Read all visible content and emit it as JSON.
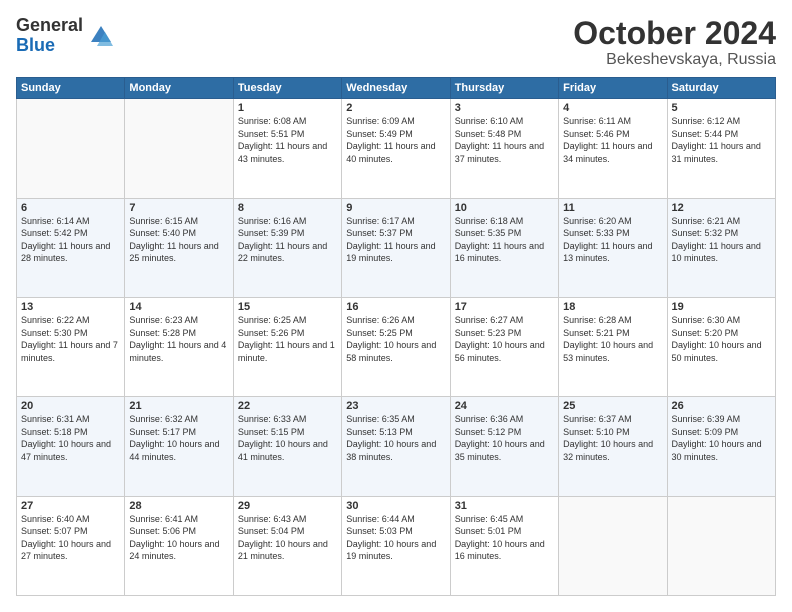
{
  "logo": {
    "general": "General",
    "blue": "Blue"
  },
  "title": "October 2024",
  "subtitle": "Bekeshevskaya, Russia",
  "headers": [
    "Sunday",
    "Monday",
    "Tuesday",
    "Wednesday",
    "Thursday",
    "Friday",
    "Saturday"
  ],
  "weeks": [
    [
      {
        "day": "",
        "info": ""
      },
      {
        "day": "",
        "info": ""
      },
      {
        "day": "1",
        "info": "Sunrise: 6:08 AM\nSunset: 5:51 PM\nDaylight: 11 hours and 43 minutes."
      },
      {
        "day": "2",
        "info": "Sunrise: 6:09 AM\nSunset: 5:49 PM\nDaylight: 11 hours and 40 minutes."
      },
      {
        "day": "3",
        "info": "Sunrise: 6:10 AM\nSunset: 5:48 PM\nDaylight: 11 hours and 37 minutes."
      },
      {
        "day": "4",
        "info": "Sunrise: 6:11 AM\nSunset: 5:46 PM\nDaylight: 11 hours and 34 minutes."
      },
      {
        "day": "5",
        "info": "Sunrise: 6:12 AM\nSunset: 5:44 PM\nDaylight: 11 hours and 31 minutes."
      }
    ],
    [
      {
        "day": "6",
        "info": "Sunrise: 6:14 AM\nSunset: 5:42 PM\nDaylight: 11 hours and 28 minutes."
      },
      {
        "day": "7",
        "info": "Sunrise: 6:15 AM\nSunset: 5:40 PM\nDaylight: 11 hours and 25 minutes."
      },
      {
        "day": "8",
        "info": "Sunrise: 6:16 AM\nSunset: 5:39 PM\nDaylight: 11 hours and 22 minutes."
      },
      {
        "day": "9",
        "info": "Sunrise: 6:17 AM\nSunset: 5:37 PM\nDaylight: 11 hours and 19 minutes."
      },
      {
        "day": "10",
        "info": "Sunrise: 6:18 AM\nSunset: 5:35 PM\nDaylight: 11 hours and 16 minutes."
      },
      {
        "day": "11",
        "info": "Sunrise: 6:20 AM\nSunset: 5:33 PM\nDaylight: 11 hours and 13 minutes."
      },
      {
        "day": "12",
        "info": "Sunrise: 6:21 AM\nSunset: 5:32 PM\nDaylight: 11 hours and 10 minutes."
      }
    ],
    [
      {
        "day": "13",
        "info": "Sunrise: 6:22 AM\nSunset: 5:30 PM\nDaylight: 11 hours and 7 minutes."
      },
      {
        "day": "14",
        "info": "Sunrise: 6:23 AM\nSunset: 5:28 PM\nDaylight: 11 hours and 4 minutes."
      },
      {
        "day": "15",
        "info": "Sunrise: 6:25 AM\nSunset: 5:26 PM\nDaylight: 11 hours and 1 minute."
      },
      {
        "day": "16",
        "info": "Sunrise: 6:26 AM\nSunset: 5:25 PM\nDaylight: 10 hours and 58 minutes."
      },
      {
        "day": "17",
        "info": "Sunrise: 6:27 AM\nSunset: 5:23 PM\nDaylight: 10 hours and 56 minutes."
      },
      {
        "day": "18",
        "info": "Sunrise: 6:28 AM\nSunset: 5:21 PM\nDaylight: 10 hours and 53 minutes."
      },
      {
        "day": "19",
        "info": "Sunrise: 6:30 AM\nSunset: 5:20 PM\nDaylight: 10 hours and 50 minutes."
      }
    ],
    [
      {
        "day": "20",
        "info": "Sunrise: 6:31 AM\nSunset: 5:18 PM\nDaylight: 10 hours and 47 minutes."
      },
      {
        "day": "21",
        "info": "Sunrise: 6:32 AM\nSunset: 5:17 PM\nDaylight: 10 hours and 44 minutes."
      },
      {
        "day": "22",
        "info": "Sunrise: 6:33 AM\nSunset: 5:15 PM\nDaylight: 10 hours and 41 minutes."
      },
      {
        "day": "23",
        "info": "Sunrise: 6:35 AM\nSunset: 5:13 PM\nDaylight: 10 hours and 38 minutes."
      },
      {
        "day": "24",
        "info": "Sunrise: 6:36 AM\nSunset: 5:12 PM\nDaylight: 10 hours and 35 minutes."
      },
      {
        "day": "25",
        "info": "Sunrise: 6:37 AM\nSunset: 5:10 PM\nDaylight: 10 hours and 32 minutes."
      },
      {
        "day": "26",
        "info": "Sunrise: 6:39 AM\nSunset: 5:09 PM\nDaylight: 10 hours and 30 minutes."
      }
    ],
    [
      {
        "day": "27",
        "info": "Sunrise: 6:40 AM\nSunset: 5:07 PM\nDaylight: 10 hours and 27 minutes."
      },
      {
        "day": "28",
        "info": "Sunrise: 6:41 AM\nSunset: 5:06 PM\nDaylight: 10 hours and 24 minutes."
      },
      {
        "day": "29",
        "info": "Sunrise: 6:43 AM\nSunset: 5:04 PM\nDaylight: 10 hours and 21 minutes."
      },
      {
        "day": "30",
        "info": "Sunrise: 6:44 AM\nSunset: 5:03 PM\nDaylight: 10 hours and 19 minutes."
      },
      {
        "day": "31",
        "info": "Sunrise: 6:45 AM\nSunset: 5:01 PM\nDaylight: 10 hours and 16 minutes."
      },
      {
        "day": "",
        "info": ""
      },
      {
        "day": "",
        "info": ""
      }
    ]
  ]
}
